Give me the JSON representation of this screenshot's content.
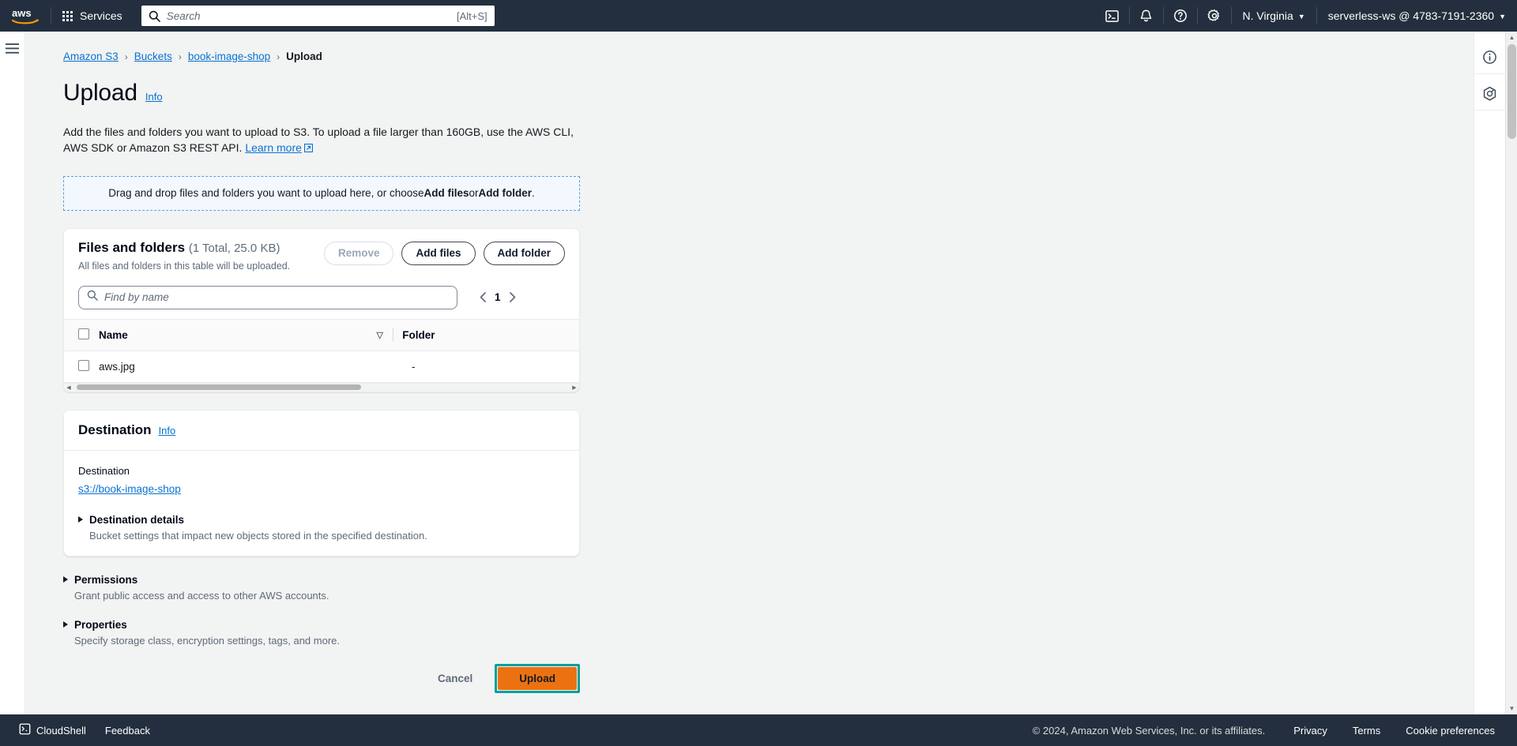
{
  "topnav": {
    "logo_alt": "aws",
    "services_label": "Services",
    "search_placeholder": "Search",
    "search_value": "",
    "search_shortcut": "[Alt+S]",
    "region_label": "N. Virginia",
    "account_label": "serverless-ws @ 4783-7191-2360",
    "icons": {
      "cloudshell": "cloudshell-icon",
      "notifications": "bell-icon",
      "help": "help-circle-icon",
      "settings": "gear-icon"
    }
  },
  "breadcrumb": {
    "items": [
      {
        "label": "Amazon S3",
        "link": true
      },
      {
        "label": "Buckets",
        "link": true
      },
      {
        "label": "book-image-shop",
        "link": true
      },
      {
        "label": "Upload",
        "link": false
      }
    ],
    "separator": "›"
  },
  "page": {
    "title": "Upload",
    "info_label": "Info",
    "description_part1": "Add the files and folders you want to upload to S3. To upload a file larger than 160GB, use the AWS CLI, AWS SDK or Amazon S3 REST API.",
    "learn_more_label": "Learn more"
  },
  "dropzone": {
    "text_before": "Drag and drop files and folders you want to upload here, or choose ",
    "bold1": "Add files",
    "text_middle": " or ",
    "bold2": "Add folder",
    "text_after": "."
  },
  "files_card": {
    "title": "Files and folders",
    "count_label": "(1 Total, 25.0 KB)",
    "subtitle": "All files and folders in this table will be uploaded.",
    "remove_label": "Remove",
    "add_files_label": "Add files",
    "add_folder_label": "Add folder",
    "find_placeholder": "Find by name",
    "find_value": "",
    "page_number": "1",
    "columns": [
      "Name",
      "Folder"
    ],
    "rows": [
      {
        "name": "aws.jpg",
        "folder": "-"
      }
    ]
  },
  "destination_card": {
    "title": "Destination",
    "info_label": "Info",
    "field_label": "Destination",
    "destination_uri": "s3://book-image-shop",
    "details_title": "Destination details",
    "details_subtitle": "Bucket settings that impact new objects stored in the specified destination."
  },
  "sections": [
    {
      "title": "Permissions",
      "subtitle": "Grant public access and access to other AWS accounts."
    },
    {
      "title": "Properties",
      "subtitle": "Specify storage class, encryption settings, tags, and more."
    }
  ],
  "actions": {
    "cancel_label": "Cancel",
    "upload_label": "Upload",
    "upload_bg": "#ec7211",
    "upload_focus_ring": "#00a19b"
  },
  "rightrail": {
    "info_icon": "info-circle-icon",
    "cost_icon": "hexagon-tool-icon"
  },
  "bottombar": {
    "cloudshell_label": "CloudShell",
    "feedback_label": "Feedback",
    "copyright": "© 2024, Amazon Web Services, Inc. or its affiliates.",
    "links": [
      "Privacy",
      "Terms",
      "Cookie preferences"
    ]
  }
}
